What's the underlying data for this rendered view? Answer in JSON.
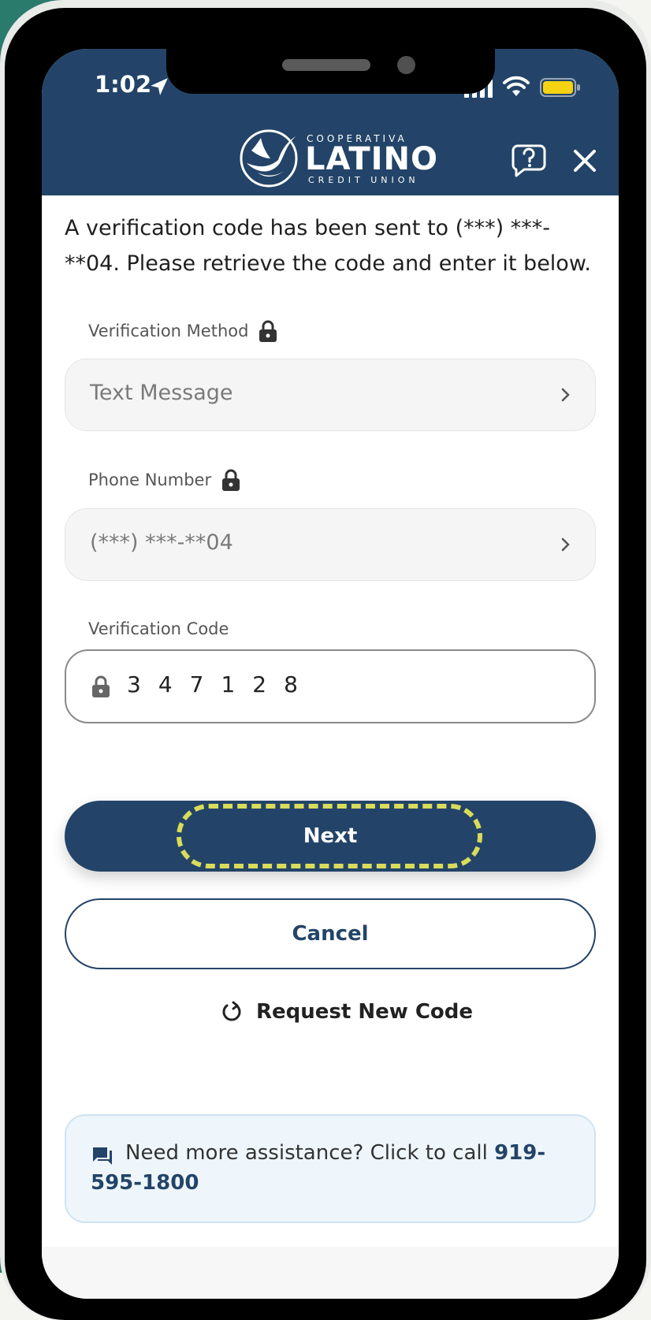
{
  "status_bar": {
    "time": "1:02"
  },
  "header": {
    "logo_top": "COOPERATIVA",
    "logo_main": "LATINO",
    "logo_bottom": "CREDIT UNION"
  },
  "intro_text": "A verification code has been sent to (***) ***-**04. Please retrieve the code and enter it below.",
  "fields": {
    "method_label": "Verification Method",
    "method_value": "Text Message",
    "phone_label": "Phone Number",
    "phone_value": "(***) ***-**04",
    "code_label": "Verification Code",
    "code_value": "347128"
  },
  "buttons": {
    "next": "Next",
    "cancel": "Cancel",
    "request_new": "Request New Code"
  },
  "assist": {
    "text": "Need more assistance? Click to call ",
    "phone": "919-595-1800"
  },
  "colors": {
    "brand_navy": "#234468",
    "highlight": "#d8dc5a",
    "background_teal": "#2a7b6c"
  }
}
